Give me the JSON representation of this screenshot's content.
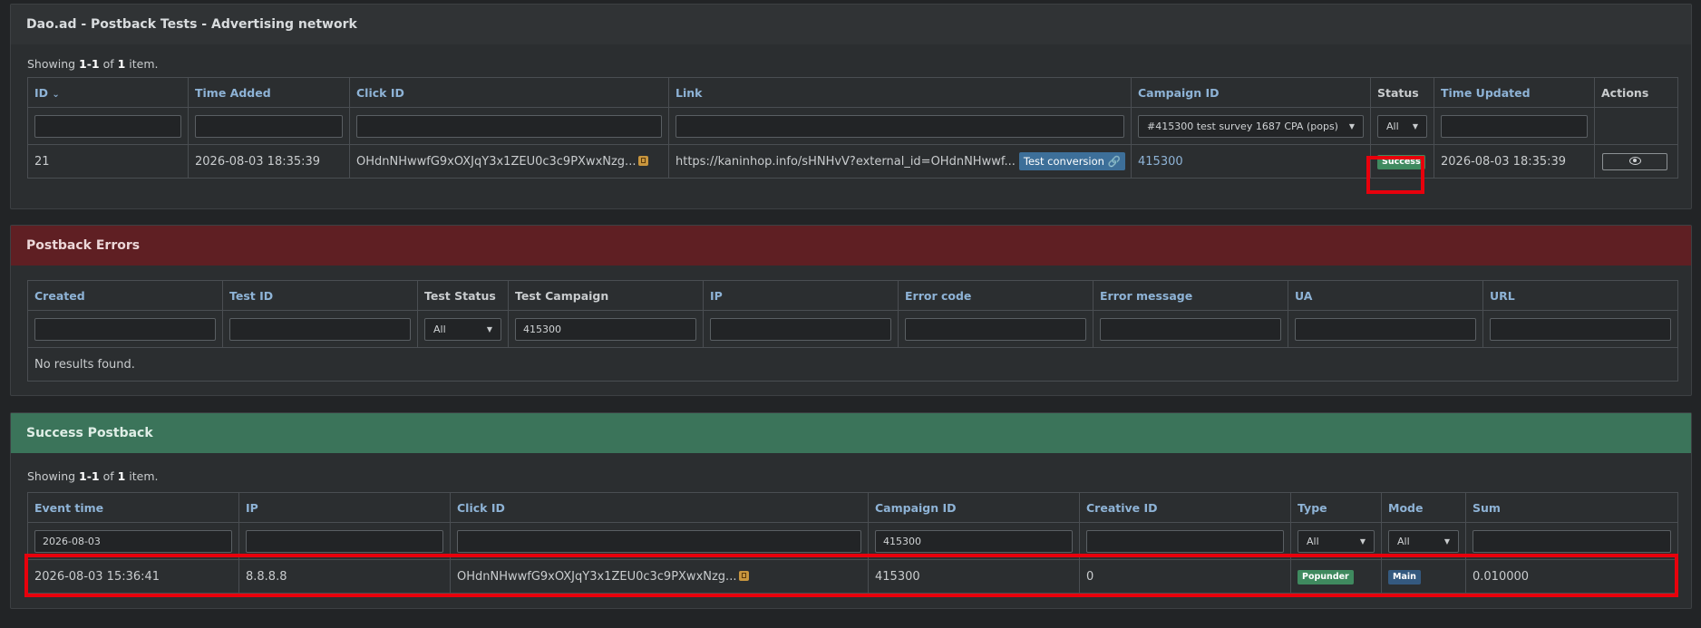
{
  "tests": {
    "title": "Dao.ad - Postback Tests - Advertising network",
    "summary": {
      "prefix": "Showing ",
      "range": "1-1",
      "middle": " of ",
      "total": "1",
      "suffix": " item."
    },
    "headers": [
      "ID",
      "Time Added",
      "Click ID",
      "Link",
      "Campaign ID",
      "Status",
      "Time Updated",
      "Actions"
    ],
    "sort_indicator": "⌄",
    "filters": {
      "campaign": "#415300 test survey 1687 CPA (pops)",
      "status": "All"
    },
    "row": {
      "id": "21",
      "time_added": "2026-08-03 18:35:39",
      "click_id": "OHdnNHwwfG9xOXJqY3x1ZEU0c3c9PXwxNzg...",
      "link": "https://kaninhop.info/sHNHvV?external_id=OHdnNHwwf...",
      "test_button": "Test conversion",
      "campaign_id": "415300",
      "status": "Success",
      "time_updated": "2026-08-03 18:35:39"
    }
  },
  "errors": {
    "title": "Postback Errors",
    "headers": [
      "Created",
      "Test ID",
      "Test Status",
      "Test Campaign",
      "IP",
      "Error code",
      "Error message",
      "UA",
      "URL"
    ],
    "filters": {
      "test_status": "All",
      "test_campaign": "415300"
    },
    "empty": "No results found."
  },
  "success": {
    "title": "Success Postback",
    "summary": {
      "prefix": "Showing ",
      "range": "1-1",
      "middle": " of ",
      "total": "1",
      "suffix": " item."
    },
    "headers": [
      "Event time",
      "IP",
      "Click ID",
      "Campaign ID",
      "Creative ID",
      "Type",
      "Mode",
      "Sum"
    ],
    "filters": {
      "event_time": "2026-08-03",
      "campaign_id": "415300",
      "type": "All",
      "mode": "All"
    },
    "row": {
      "event_time": "2026-08-03 15:36:41",
      "ip": "8.8.8.8",
      "click_id": "OHdnNHwwfG9xOXJqY3x1ZEU0c3c9PXwxNzg...",
      "campaign_id": "415300",
      "creative_id": "0",
      "type": "Popunder",
      "mode": "Main",
      "sum": "0.010000"
    }
  },
  "colors": {
    "highlight": "#e8000c",
    "success_badge": "#3f8a5f",
    "main_badge": "#34597f",
    "error_header": "#5f1f23",
    "success_header": "#3b745a"
  }
}
